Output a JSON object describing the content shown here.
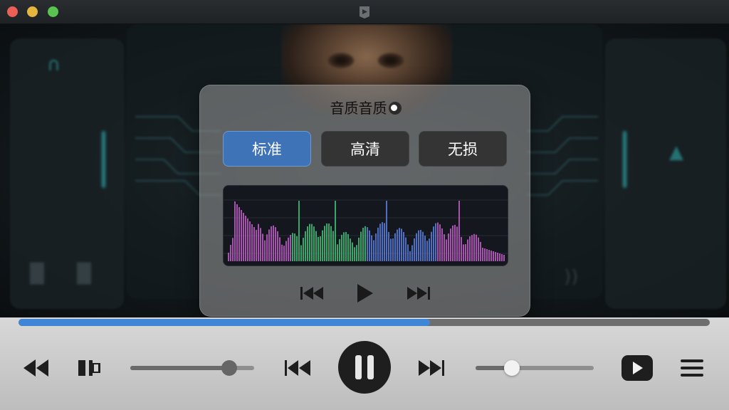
{
  "window": {
    "controls": [
      "close",
      "minimize",
      "zoom"
    ],
    "app_icon": "player-app-icon"
  },
  "quality_panel": {
    "title": "音质音质",
    "toggle_icon": "radio-dot-icon",
    "options": [
      {
        "label": "标准",
        "selected": true
      },
      {
        "label": "高清",
        "selected": false
      },
      {
        "label": "无损",
        "selected": false
      }
    ],
    "spectrum_colors": [
      "#c05fc8",
      "#3fc07a",
      "#5a7fe0",
      "#c05fc8"
    ],
    "controls": [
      "skip-back-icon",
      "play-icon",
      "skip-forward-icon"
    ]
  },
  "player": {
    "progress": 0.595,
    "volume_left": 0.8,
    "volume_right": 0.31,
    "accent": "#3f86d6",
    "controls": [
      "rewind-icon",
      "bracket-icon",
      "skip-back-icon",
      "pause-icon",
      "skip-forward-icon",
      "play-icon",
      "menu-icon"
    ]
  }
}
